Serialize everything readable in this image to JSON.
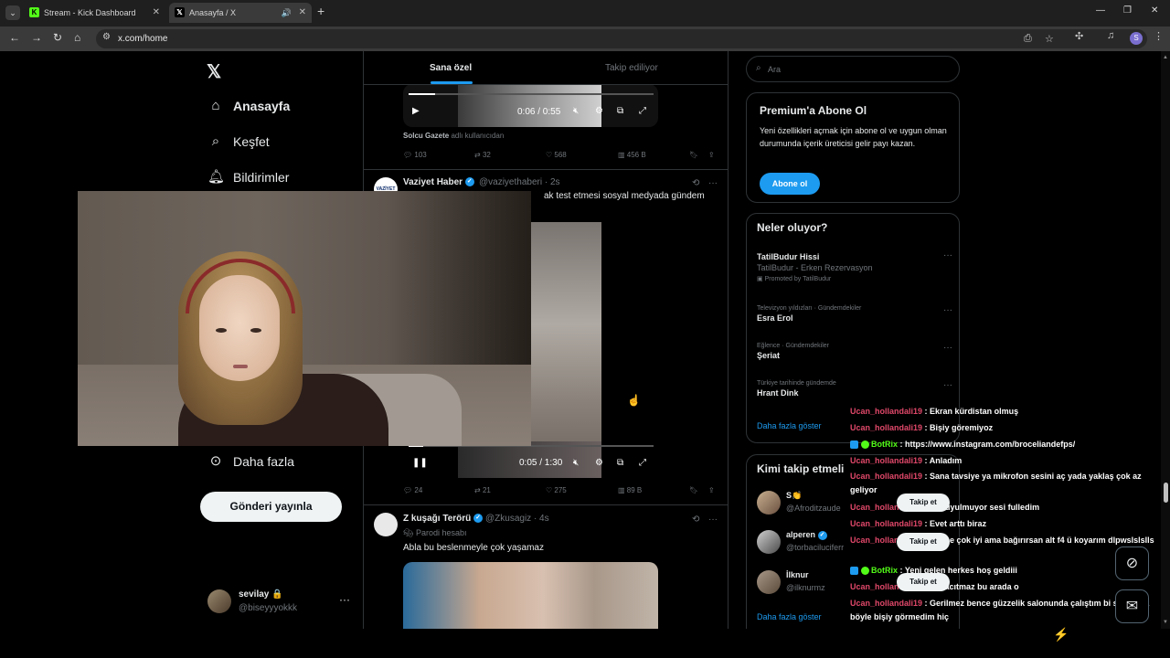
{
  "browser": {
    "tabs": [
      {
        "title": "Stream - Kick Dashboard",
        "favicon": "kick-icon"
      },
      {
        "title": "Anasayfa / X",
        "favicon": "x-icon"
      }
    ],
    "url": "x.com/home",
    "profile_initial": "S"
  },
  "sidebar": {
    "items": [
      {
        "label": "Anasayfa",
        "icon": "home-icon"
      },
      {
        "label": "Keşfet",
        "icon": "search-icon"
      },
      {
        "label": "Bildirimler",
        "icon": "bell-icon"
      },
      {
        "label": "Daha fazla",
        "icon": "more-circle-icon"
      }
    ],
    "post_button": "Gönderi yayınla",
    "account": {
      "name": "sevilay 🔒",
      "handle": "@biseyyyokkk"
    }
  },
  "timeline": {
    "tabs": [
      "Sana özel",
      "Takip ediliyor"
    ],
    "tweet1": {
      "video_time": "0:06 / 0:55",
      "video_progress": 0.11,
      "source_name": "Solcu Gazete",
      "source_suffix": "adlı kullanıcıdan",
      "replies": "103",
      "retweets": "32",
      "likes": "568",
      "views": "456 B"
    },
    "tweet2": {
      "avatar_text": "VAZİYET",
      "name": "Vaziyet Haber",
      "handle": "@vaziyethaberi · 2s",
      "text_visible": "ak test etmesi sosyal medyada gündem",
      "video_time": "0:05 / 1:30",
      "video_progress": 0.06,
      "replies": "24",
      "retweets": "21",
      "likes": "275",
      "views": "89 B"
    },
    "tweet3": {
      "name": "Z kuşağı Terörü",
      "handle": "@Zkusagiz · 4s",
      "parody": "Parodi hesabı",
      "text": "Abla bu beslenmeyle çok yaşamaz"
    }
  },
  "right": {
    "search_placeholder": "Ara",
    "premium": {
      "title": "Premium'a Abone Ol",
      "text": "Yeni özellikleri açmak için abone ol ve uygun olman durumunda içerik üreticisi gelir payı kazan.",
      "button": "Abone ol"
    },
    "trends": {
      "title": "Neler oluyor?",
      "items": [
        {
          "context": "",
          "title": "TatilBudur Hissi",
          "extra": "TatilBudur - Erken Rezervasyon",
          "extra2": "Promoted by TatilBudur"
        },
        {
          "context": "Televizyon yıldızları · Gündemdekiler",
          "title": "Esra Erol"
        },
        {
          "context": "Eğlence · Gündemdekiler",
          "title": "Şeriat"
        },
        {
          "context": "Türkiye tarihinde gündemde",
          "title": "Hrant Dink"
        }
      ],
      "show_more": "Daha fazla göster"
    },
    "who_to_follow": {
      "title": "Kimi takip etmeli",
      "items": [
        {
          "name": "S👏",
          "handle": "@Afroditzaude"
        },
        {
          "name": "alperen",
          "handle": "@torbaciluciferr"
        },
        {
          "name": "İlknur",
          "handle": "@ilknurmz"
        }
      ],
      "follow_label": "Takip et",
      "show_more": "Daha fazla göster"
    }
  },
  "chat": {
    "messages": [
      {
        "user": "Ucan_hollandali19",
        "text": ": Ekran kürdistan olmuş",
        "bot": false
      },
      {
        "user": "Ucan_hollandali19",
        "text": ": Bişiy göremiyoz",
        "bot": false
      },
      {
        "user": "BotRix",
        "text": ": https://www.instagram.com/broceliandefps/",
        "bot": true
      },
      {
        "user": "Ucan_hollandali19",
        "text": ": Anladım",
        "bot": false
      },
      {
        "user": "Ucan_hollandali19",
        "text": ": Sana tavsiye ya mikrofon sesini aç yada yaklaş çok az geliyor",
        "bot": false
      },
      {
        "user": "Ucan_hollandali19",
        "text": ": Bi duyulmuyor sesi fulledim",
        "bot": false
      },
      {
        "user": "Ucan_hollandali19",
        "text": ": Evet arttı biraz",
        "bot": false
      },
      {
        "user": "Ucan_hollandali19",
        "text": ": Bence çok iyi ama bağırırsan alt f4 ü koyarım dlpwslslslls",
        "bot": false
      },
      {
        "user": "BotRix",
        "text": ": Yeni gelen herkes hoş geldiii",
        "bot": true
      },
      {
        "user": "Ucan_hollandali19",
        "text": ": Hiç acıtmaz bu arada o",
        "bot": false
      },
      {
        "user": "Ucan_hollandali19",
        "text": ": Gerilmez bence güzzelik salonunda çalıştım bi süre ama böyle bişiy görmedim hiç",
        "bot": false
      }
    ]
  },
  "colors": {
    "accent": "#1d9bf0",
    "kick_green": "#53fc18",
    "chat_user": "#e1486a"
  }
}
